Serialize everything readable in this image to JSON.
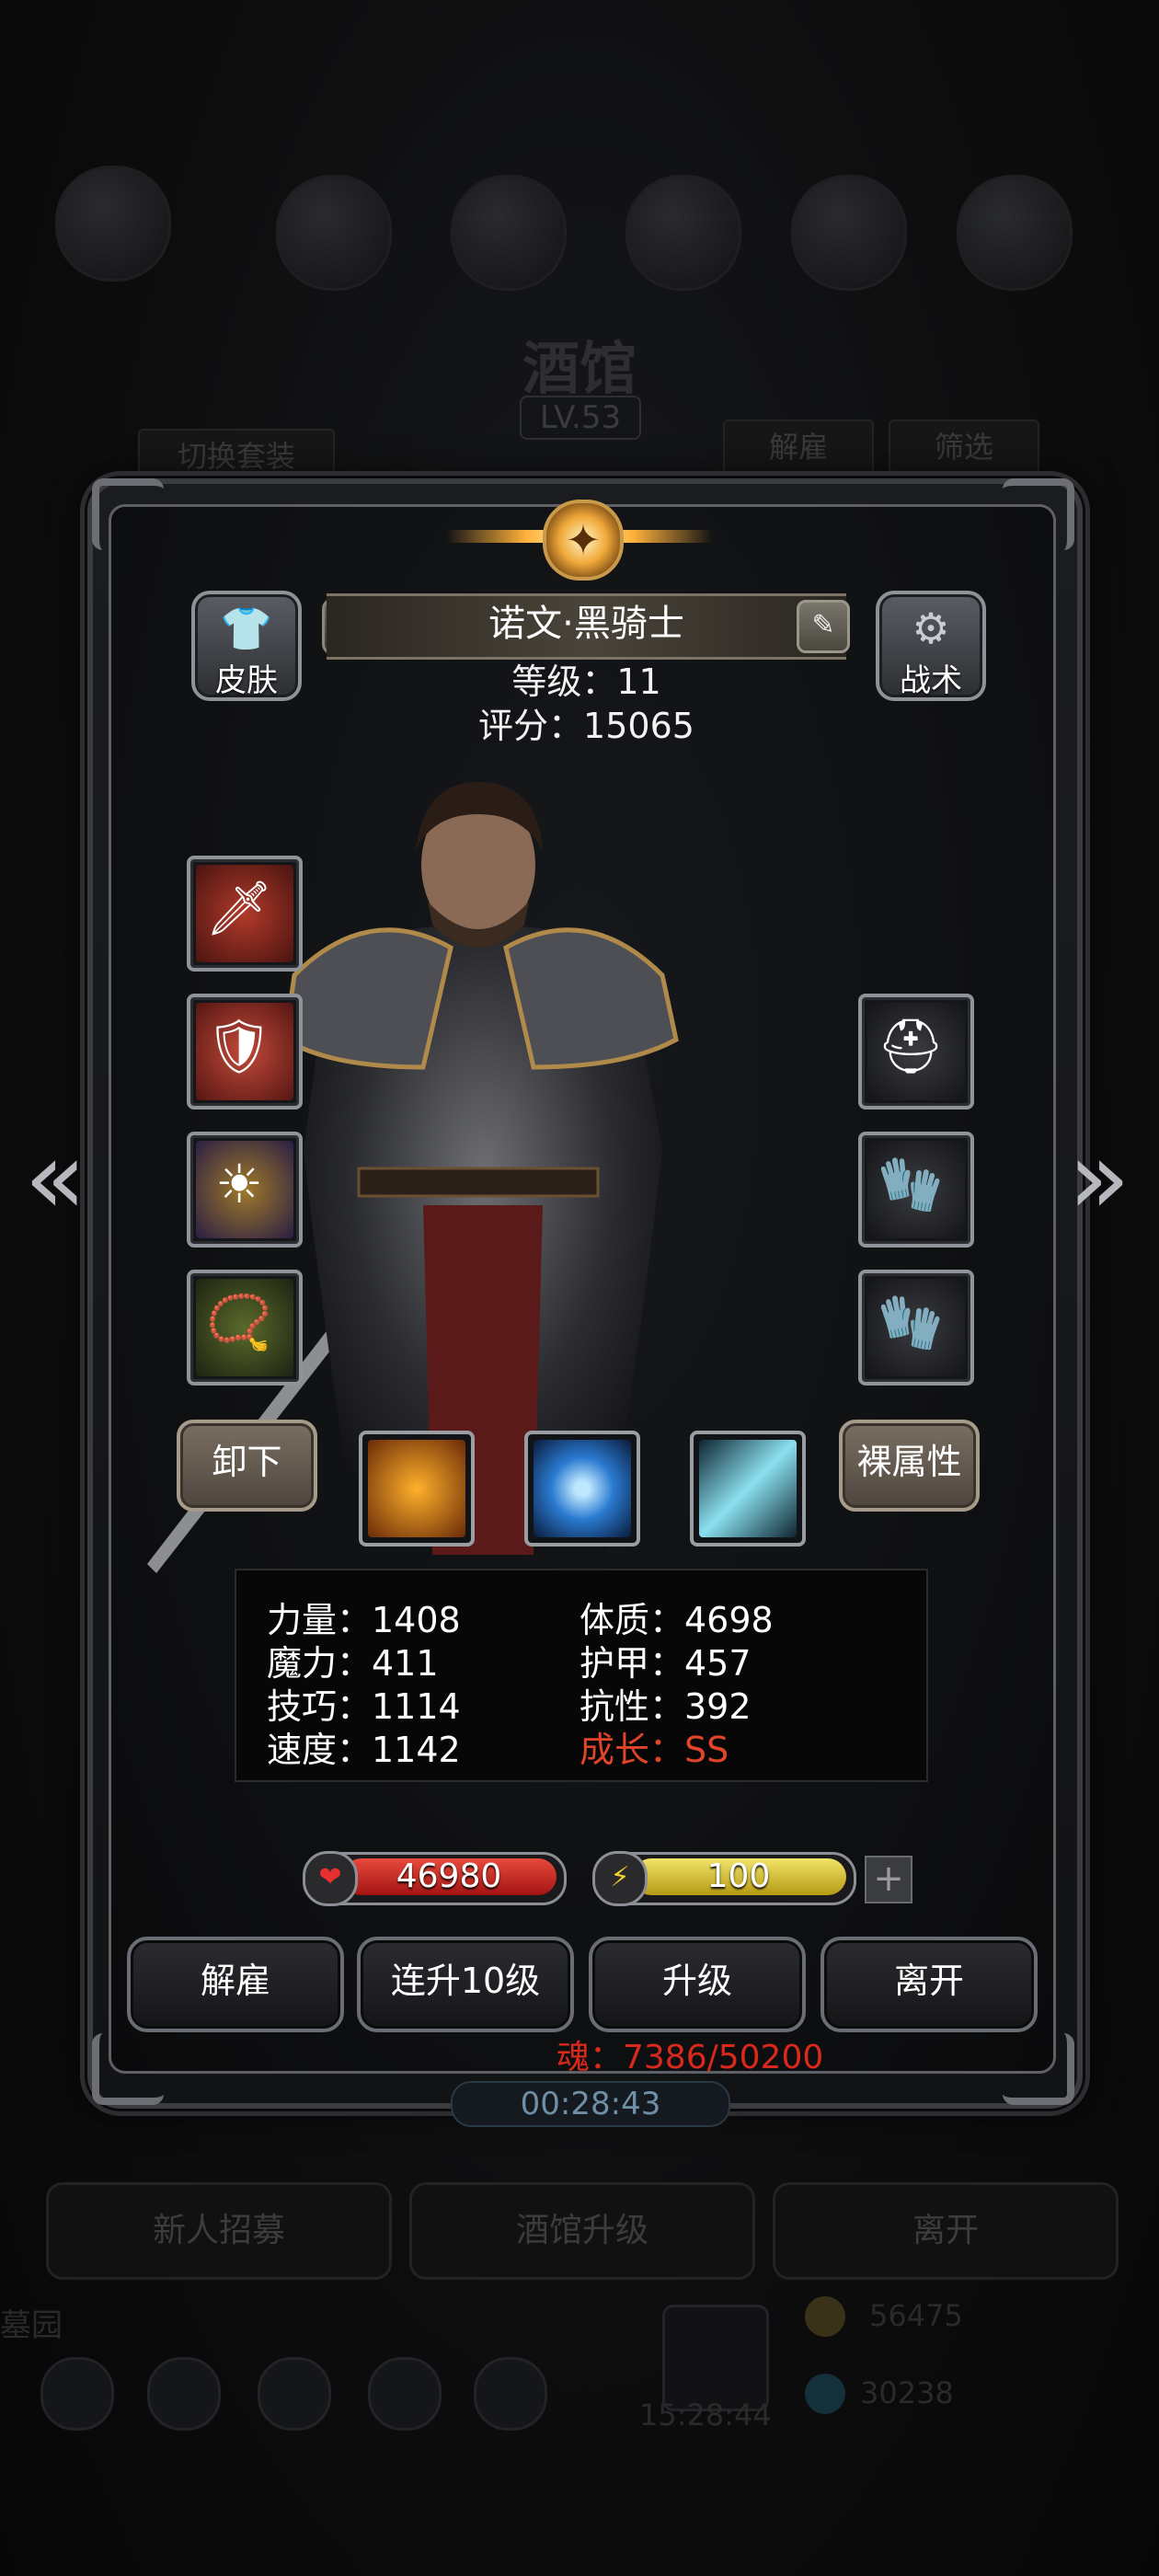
{
  "background": {
    "title": "酒馆",
    "level": "LV.53",
    "switch_outfit": "切换套装",
    "dismiss": "解雇",
    "filter": "筛选",
    "recruit": "新人招募",
    "tavern_upgrade": "酒馆升级",
    "leave": "离开",
    "side_text": "墓园",
    "gold": "56475",
    "gems": "30238",
    "clock": "15:28:44"
  },
  "hero": {
    "name": "诺文·黑骑士",
    "level_line": "等级：11",
    "score_line": "评分：15065",
    "skin_label": "皮肤",
    "tactics_label": "战术"
  },
  "equipment": {
    "left": [
      "sword-icon",
      "chest-armor-icon",
      "amulet-icon",
      "necklace-icon"
    ],
    "right": [
      "helmet-icon",
      "glove-icon",
      "glove-icon"
    ]
  },
  "actions": {
    "unequip": "卸下",
    "base_attributes": "裸属性"
  },
  "skills": [
    "shield-skill-icon",
    "eye-skill-icon",
    "slash-skill-icon"
  ],
  "stats": {
    "strength": "力量：1408",
    "constitution": "体质：4698",
    "magic": "魔力：411",
    "armor": "护甲：457",
    "skill": "技巧：1114",
    "resistance": "抗性：392",
    "speed": "速度：1142",
    "growth": "成长：SS"
  },
  "bars": {
    "hp": "46980",
    "energy": "100",
    "plus": "+"
  },
  "buttons": {
    "dismiss": "解雇",
    "upgrade10": "连升10级",
    "upgrade": "升级",
    "leave": "离开"
  },
  "soul": "魂：7386/50200",
  "timer": "00:28:43",
  "colors": {
    "hp": "#c8201e",
    "energy": "#d8c62a",
    "growth": "#e0452a",
    "soul": "#d9281c"
  }
}
